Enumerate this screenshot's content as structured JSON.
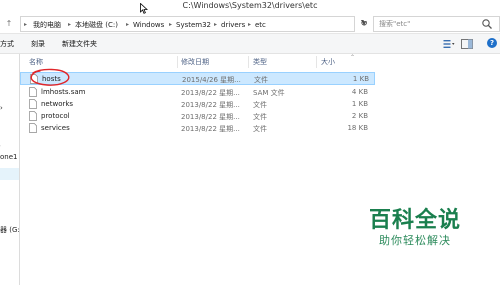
{
  "window": {
    "title": "C:\\Windows\\System32\\drivers\\etc"
  },
  "address": {
    "crumbs": [
      "我的电脑",
      "本地磁盘 (C:)",
      "Windows",
      "System32",
      "drivers",
      "etc"
    ],
    "search_placeholder": "搜索\"etc\""
  },
  "toolbar": {
    "items": [
      "方式",
      "刻录",
      "新建文件夹"
    ]
  },
  "nav": {
    "items": [
      "one1",
      "器 (G:"
    ]
  },
  "columns": {
    "name": "名称",
    "date": "修改日期",
    "type": "类型",
    "size": "大小"
  },
  "files": [
    {
      "name": "hosts",
      "date": "2015/4/26 星期...",
      "type": "文件",
      "size": "1 KB",
      "selected": true
    },
    {
      "name": "lmhosts.sam",
      "date": "2013/8/22 星期...",
      "type": "SAM 文件",
      "size": "4 KB",
      "selected": false
    },
    {
      "name": "networks",
      "date": "2013/8/22 星期...",
      "type": "文件",
      "size": "1 KB",
      "selected": false
    },
    {
      "name": "protocol",
      "date": "2013/8/22 星期...",
      "type": "文件",
      "size": "2 KB",
      "selected": false
    },
    {
      "name": "services",
      "date": "2013/8/22 星期...",
      "type": "文件",
      "size": "18 KB",
      "selected": false
    }
  ],
  "watermark": {
    "title": "百科全说",
    "subtitle": "助你轻松解决"
  },
  "colors": {
    "selection": "#cce8ff",
    "annotation": "#e0262a",
    "watermark": "#1a7f4e"
  }
}
